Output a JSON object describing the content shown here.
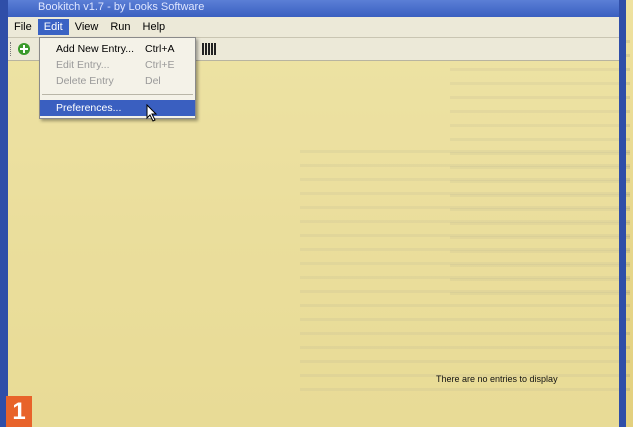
{
  "window": {
    "title": "Bookitch v1.7 - by Looks Software"
  },
  "menubar": {
    "items": [
      "File",
      "Edit",
      "View",
      "Run",
      "Help"
    ]
  },
  "edit_menu": {
    "items": [
      {
        "label": "Add New Entry...",
        "shortcut": "Ctrl+A"
      },
      {
        "label": "Edit Entry...",
        "shortcut": "Ctrl+E"
      },
      {
        "label": "Delete Entry",
        "shortcut": "Del"
      },
      {
        "label": "Preferences..."
      }
    ]
  },
  "content": {
    "empty_message": "There are no entries to display"
  },
  "step_badge": "1",
  "colors": {
    "window_frame": "#2f4ea8",
    "highlight": "#3a5fc0",
    "badge": "#e8632a"
  }
}
